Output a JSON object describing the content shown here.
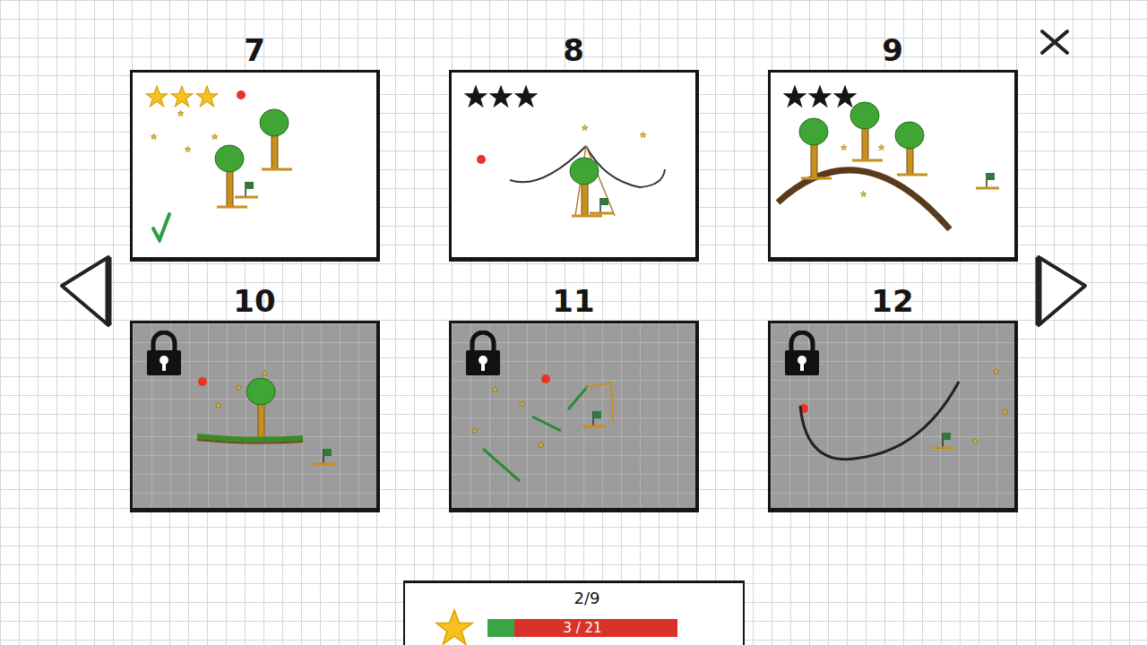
{
  "levels": [
    {
      "number": "7",
      "locked": false,
      "completed": true,
      "stars": 3,
      "kind": "trees"
    },
    {
      "number": "8",
      "locked": false,
      "completed": false,
      "stars": 0,
      "kind": "bowl"
    },
    {
      "number": "9",
      "locked": false,
      "completed": false,
      "stars": 0,
      "kind": "hill"
    },
    {
      "number": "10",
      "locked": true,
      "completed": false,
      "stars": 0,
      "kind": "ledge"
    },
    {
      "number": "11",
      "locked": true,
      "completed": false,
      "stars": 0,
      "kind": "sticks"
    },
    {
      "number": "12",
      "locked": true,
      "completed": false,
      "stars": 0,
      "kind": "curve"
    }
  ],
  "progress": {
    "levels_done": "2/9",
    "stars_text": "3 / 21",
    "level": 0.143
  }
}
